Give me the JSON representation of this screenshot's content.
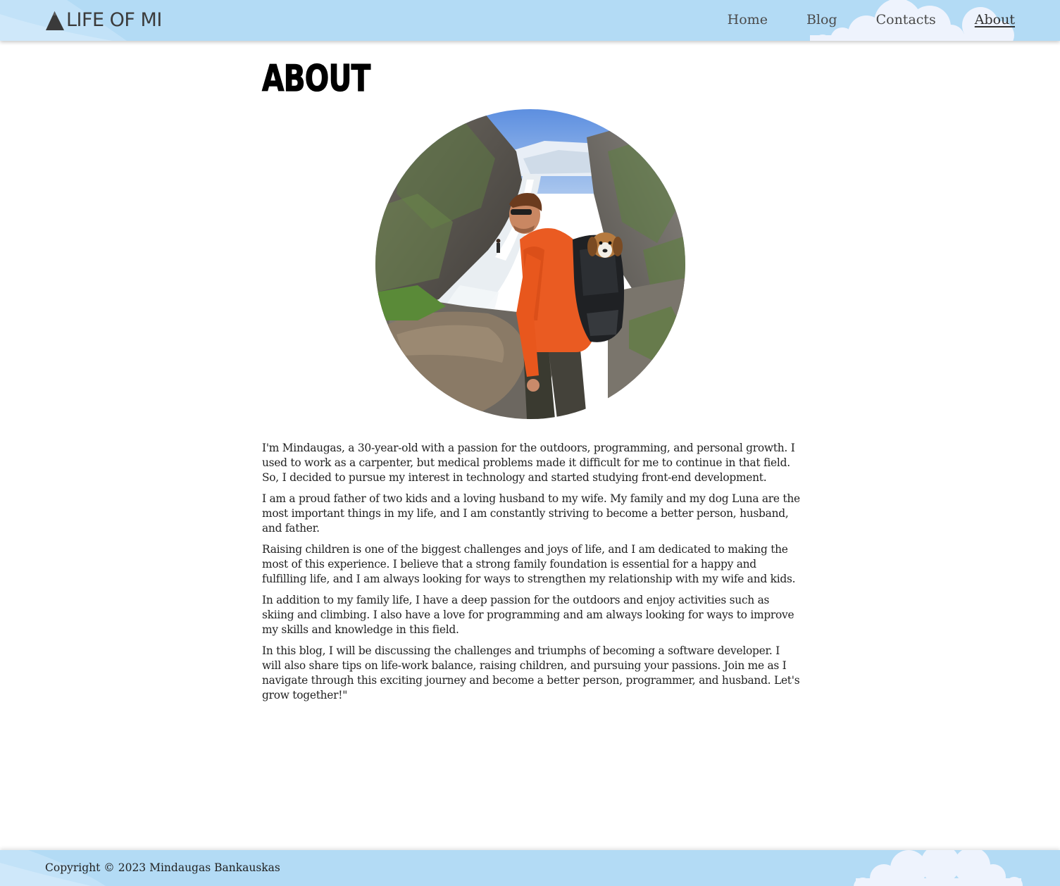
{
  "brand": {
    "logo_icon": "mountain-icon",
    "name": "LIFE OF MI"
  },
  "nav": {
    "items": [
      {
        "label": "Home",
        "active": false
      },
      {
        "label": "Blog",
        "active": false
      },
      {
        "label": "Contacts",
        "active": false
      },
      {
        "label": "About",
        "active": true
      }
    ]
  },
  "main": {
    "title": "About",
    "paragraphs": [
      "I'm Mindaugas, a 30-year-old with a passion for the outdoors, programming, and personal growth. I used to work as a carpenter, but medical problems made it difficult for me to continue in that field. So, I decided to pursue my interest in technology and started studying front-end development.",
      "I am a proud father of two kids and a loving husband to my wife. My family and my dog Luna are the most important things in my life, and I am constantly striving to become a better person, husband, and father.",
      "Raising children is one of the biggest challenges and joys of life, and I am dedicated to making the most of this experience. I believe that a strong family foundation is essential for a happy and fulfilling life, and I am always looking for ways to strengthen my relationship with my wife and kids.",
      "In addition to my family life, I have a deep passion for the outdoors and enjoy activities such as skiing and climbing. I also have a love for programming and am always looking for ways to improve my skills and knowledge in this field.",
      "In this blog, I will be discussing the challenges and triumphs of becoming a software developer. I will also share tips on life-work balance, raising children, and pursuing your passions. Join me as I navigate through this exciting journey and become a better person, programmer, and husband. Let's grow together!\""
    ]
  },
  "footer": {
    "copyright": "Copyright © 2023 Mindaugas Bankauskas"
  },
  "colors": {
    "header_bg": "#b3dbf5",
    "cloud": "#eef4fd",
    "text": "#222222"
  }
}
